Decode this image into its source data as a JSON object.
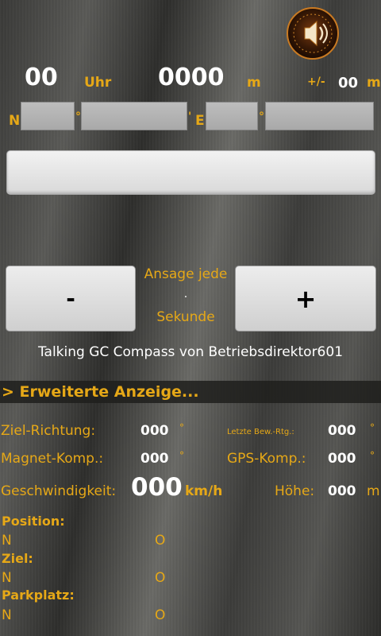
{
  "top": {
    "time_value": "00",
    "time_unit": "Uhr",
    "distance_value": "0000",
    "distance_unit": "m",
    "accuracy_prefix": "+/-",
    "accuracy_value": "00",
    "accuracy_unit": "m"
  },
  "coords": {
    "north_label": "N",
    "degree_sep": "°",
    "minute_sep": "'",
    "east_label": "E",
    "east_degree_sep": "°"
  },
  "interval": {
    "decrease_label": "-",
    "increase_label": "+",
    "line1": "Ansage jede",
    "value": ".",
    "line2": "Sekunde"
  },
  "credit": "Talking GC Compass von Betriebsdirektor601",
  "extended": {
    "header": "> Erweiterte Anzeige...",
    "target_direction_label": "Ziel-Richtung:",
    "target_direction_value": "000",
    "last_move_label": "Letzte Bew.-Rtg.:",
    "last_move_value": "000",
    "magnet_label": "Magnet-Komp.:",
    "magnet_value": "000",
    "gps_label": "GPS-Komp.:",
    "gps_value": "000",
    "speed_label": "Geschwindigkeit:",
    "speed_value": "000",
    "speed_unit": "km/h",
    "height_label": "Höhe:",
    "height_value": "000",
    "height_unit": "m",
    "degree_symbol": "°"
  },
  "positions": {
    "position_label": "Position:",
    "position_n": "N",
    "position_o": "O",
    "target_label": "Ziel:",
    "target_n": "N",
    "target_o": "O",
    "parking_label": "Parkplatz:",
    "parking_n": "N",
    "parking_o": "O"
  },
  "icons": {
    "speaker": "speaker-icon",
    "accent_color": "#e6a817"
  }
}
